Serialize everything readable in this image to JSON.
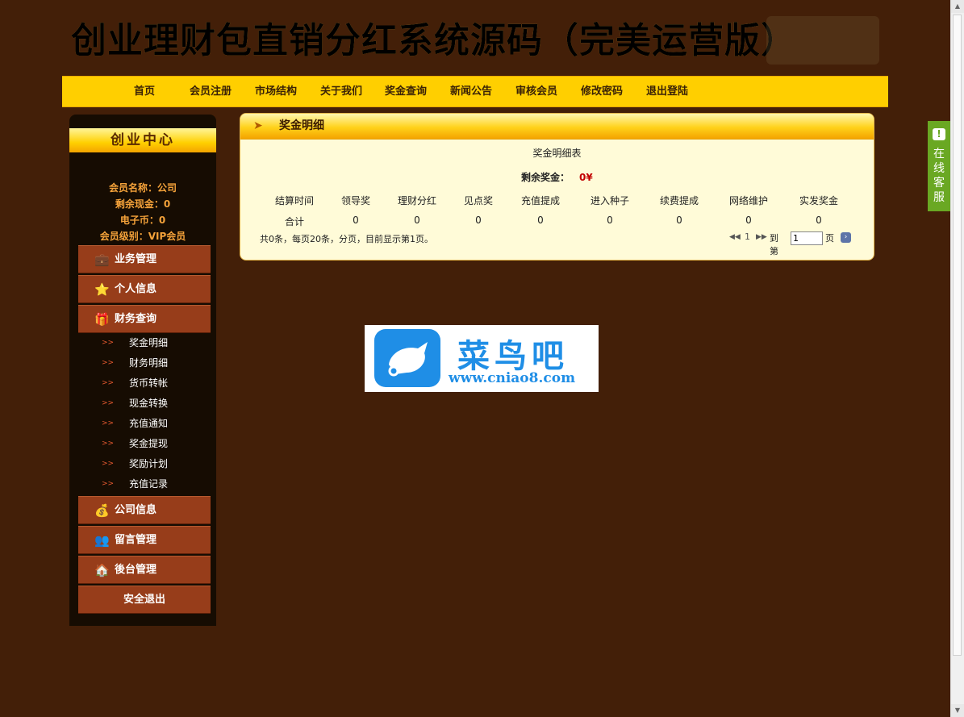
{
  "banner": {
    "title": "创业理财包直销分红系统源码（完美运营版）"
  },
  "nav": {
    "items": [
      "首页",
      "会员注册",
      "市场结构",
      "关于我们",
      "奖金查询",
      "新闻公告",
      "审核会员",
      "修改密码",
      "退出登陆"
    ]
  },
  "sidebar": {
    "heading": "创业中心",
    "member_name": "会员名称：公司",
    "cash": "剩余现金：0",
    "ecoin": "电子币：0",
    "level": "会员级别：VIP会员",
    "menus": {
      "business": "业务管理",
      "personal": "个人信息",
      "finance": "财务查询",
      "company": "公司信息",
      "messages": "留言管理",
      "backend": "後台管理",
      "logout": "安全退出"
    },
    "finance_sub": [
      "奖金明细",
      "财务明细",
      "货币转帐",
      "现金转换",
      "充值通知",
      "奖金提现",
      "奖励计划",
      "充值记录"
    ]
  },
  "panel": {
    "title": "奖金明细",
    "table_title": "奖金明细表",
    "balance_label": "剩余奖金：",
    "balance_value": "0¥",
    "columns": [
      "结算时间",
      "领导奖",
      "理财分红",
      "见点奖",
      "充值提成",
      "进入种子",
      "续费提成",
      "网络维护",
      "实发奖金"
    ],
    "total_row": [
      "合计",
      "0",
      "0",
      "0",
      "0",
      "0",
      "0",
      "0",
      "0"
    ],
    "pager_text": "共0条，每页20条，分页，目前显示第1页。",
    "pager": {
      "current": "1",
      "goto_label": "到第",
      "page_unit": "页",
      "input_value": "1"
    }
  },
  "watermark": {
    "cn": "菜鸟吧",
    "url": "www.cniao8.com"
  },
  "chat": {
    "label": "在线客服"
  }
}
